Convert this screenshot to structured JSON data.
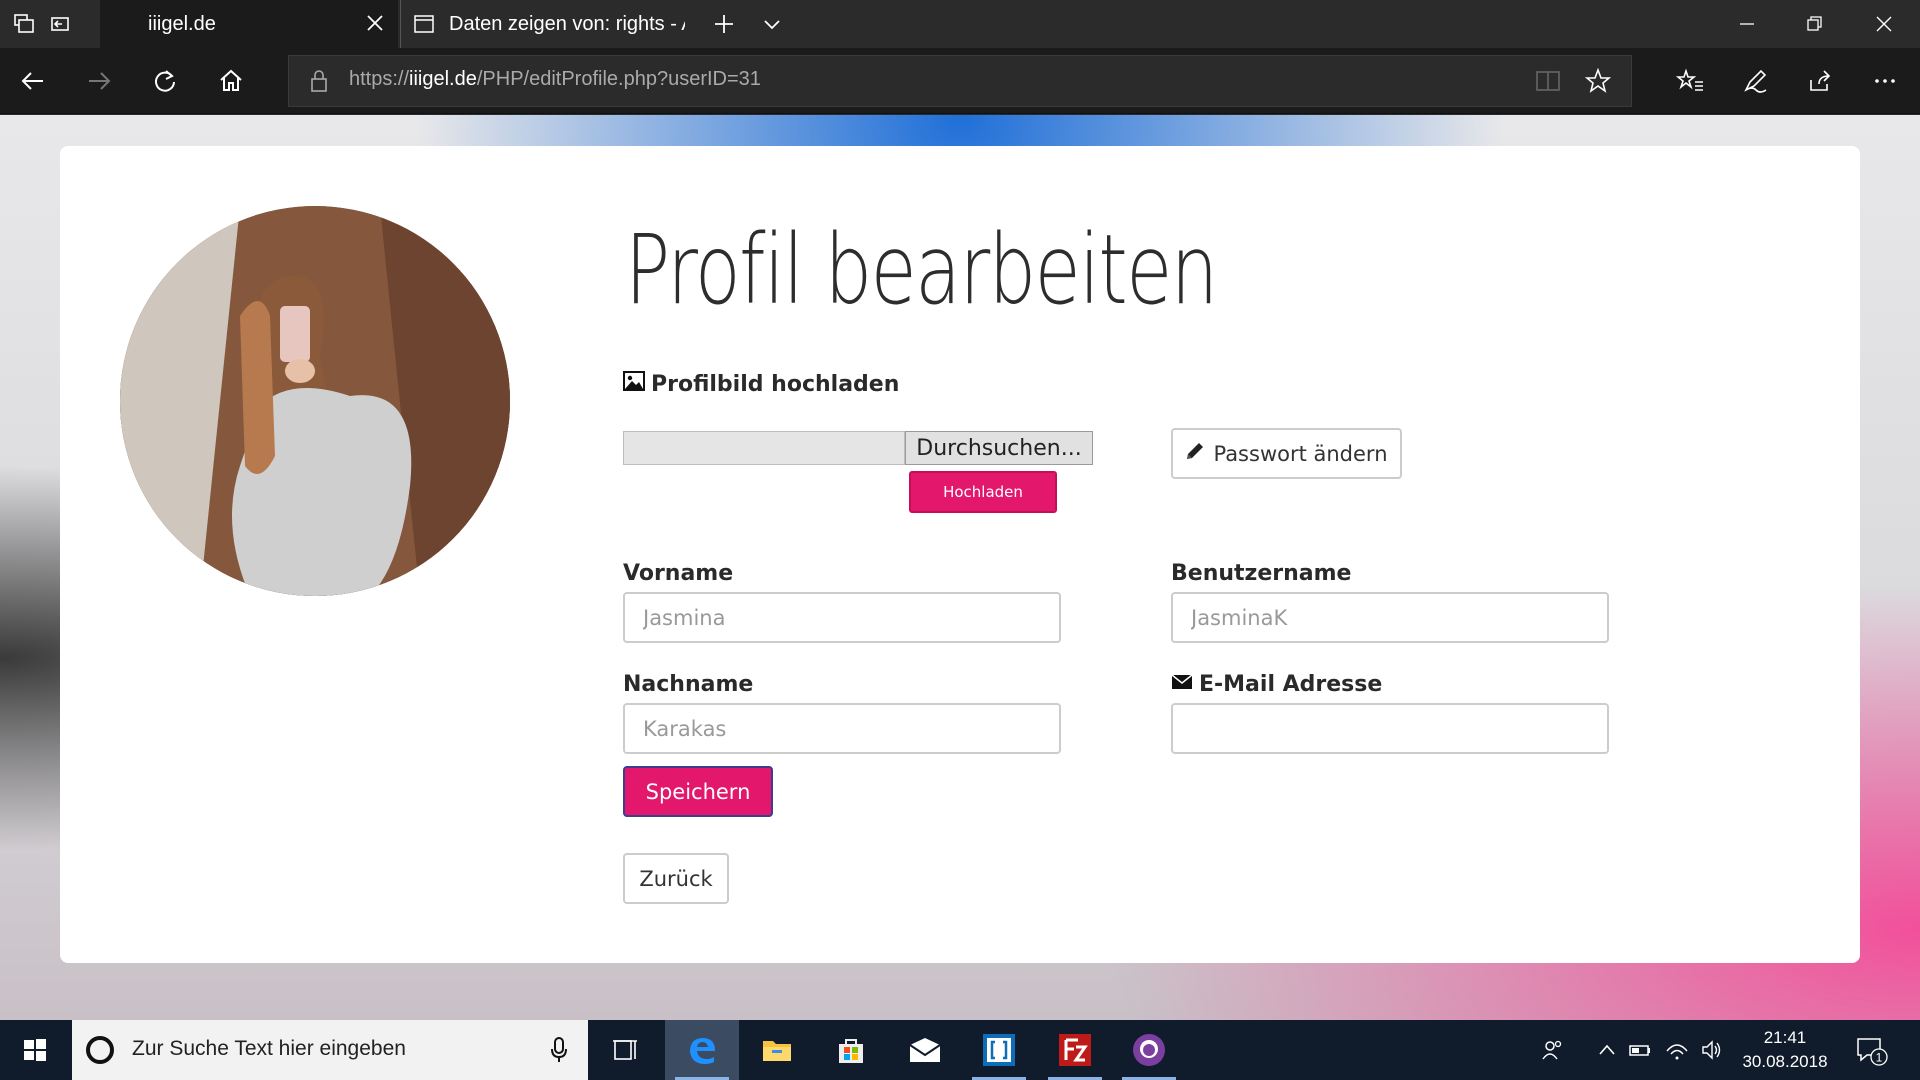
{
  "browser": {
    "tabs": [
      {
        "title": "iiigel.de",
        "active": true
      },
      {
        "title": "Daten zeigen von: rights - A",
        "active": false
      }
    ],
    "url_prefix": "https://",
    "url_domain": "iiigel.de",
    "url_path": "/PHP/editProfile.php?userID=31"
  },
  "page": {
    "title": "Profil bearbeiten",
    "upload_label": "Profilbild hochladen",
    "browse_label": "Durchsuchen...",
    "upload_button": "Hochladen",
    "password_button": "Passwort ändern",
    "firstname_label": "Vorname",
    "firstname_placeholder": "Jasmina",
    "username_label": "Benutzername",
    "username_placeholder": "JasminaK",
    "lastname_label": "Nachname",
    "lastname_placeholder": "Karakas",
    "email_label": "E-Mail Adresse",
    "email_value": "",
    "save_button": "Speichern",
    "back_button": "Zurück"
  },
  "taskbar": {
    "search_placeholder": "Zur Suche Text hier eingeben",
    "time": "21:41",
    "date": "30.08.2018",
    "notification_count": "1",
    "apps": [
      "task-view",
      "edge",
      "file-explorer",
      "store",
      "mail",
      "brackets",
      "filezilla",
      "github-desktop"
    ]
  },
  "colors": {
    "accent": "#e3186d",
    "chrome_dark": "#1b1b1b",
    "taskbar": "#101b2b"
  }
}
